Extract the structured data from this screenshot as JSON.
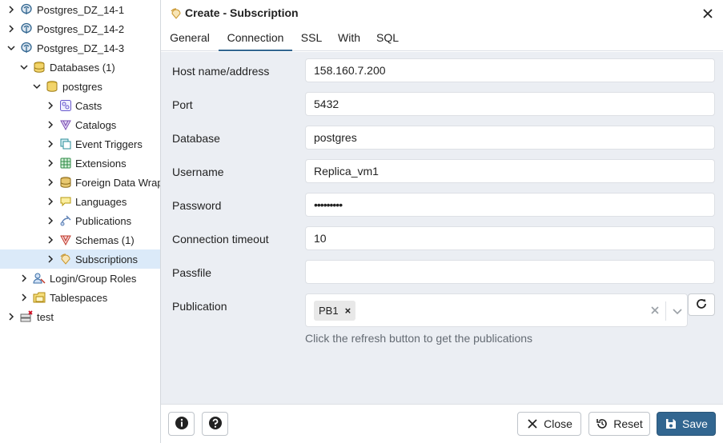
{
  "tree": {
    "items": [
      {
        "label": "Postgres_DZ_14-1",
        "icon": "postgres-server-icon",
        "expanded": false
      },
      {
        "label": "Postgres_DZ_14-2",
        "icon": "postgres-server-icon",
        "expanded": false
      },
      {
        "label": "Postgres_DZ_14-3",
        "icon": "postgres-server-icon",
        "expanded": true
      },
      {
        "label": "Databases (1)",
        "icon": "databases-icon",
        "expanded": true
      },
      {
        "label": "postgres",
        "icon": "database-icon",
        "expanded": true
      },
      {
        "label": "Casts",
        "icon": "casts-icon",
        "expanded": false
      },
      {
        "label": "Catalogs",
        "icon": "catalogs-icon",
        "expanded": false
      },
      {
        "label": "Event Triggers",
        "icon": "event-triggers-icon",
        "expanded": false
      },
      {
        "label": "Extensions",
        "icon": "extensions-icon",
        "expanded": false
      },
      {
        "label": "Foreign Data Wrap",
        "icon": "foreign-data-wrappers-icon",
        "expanded": false
      },
      {
        "label": "Languages",
        "icon": "languages-icon",
        "expanded": false
      },
      {
        "label": "Publications",
        "icon": "publications-icon",
        "expanded": false
      },
      {
        "label": "Schemas (1)",
        "icon": "schemas-icon",
        "expanded": false
      },
      {
        "label": "Subscriptions",
        "icon": "subscriptions-icon",
        "expanded": false,
        "selected": true
      },
      {
        "label": "Login/Group Roles",
        "icon": "roles-icon",
        "expanded": false
      },
      {
        "label": "Tablespaces",
        "icon": "tablespaces-icon",
        "expanded": false
      },
      {
        "label": "test",
        "icon": "disconnected-server-icon",
        "expanded": false
      }
    ]
  },
  "dialog": {
    "title": "Create - Subscription",
    "title_icon": "subscription-icon",
    "close_icon": "close-icon",
    "tabs": [
      {
        "label": "General",
        "active": false
      },
      {
        "label": "Connection",
        "active": true
      },
      {
        "label": "SSL",
        "active": false
      },
      {
        "label": "With",
        "active": false
      },
      {
        "label": "SQL",
        "active": false
      }
    ],
    "fields": {
      "host": {
        "label": "Host name/address",
        "value": "158.160.7.200"
      },
      "port": {
        "label": "Port",
        "value": "5432"
      },
      "database": {
        "label": "Database",
        "value": "postgres"
      },
      "username": {
        "label": "Username",
        "value": "Replica_vm1"
      },
      "password": {
        "label": "Password",
        "value": "•••••••••"
      },
      "timeout": {
        "label": "Connection timeout",
        "value": "10"
      },
      "passfile": {
        "label": "Passfile",
        "value": ""
      },
      "publication": {
        "label": "Publication",
        "selected": [
          "PB1"
        ]
      }
    },
    "hint": "Click the refresh button to get the publications",
    "footer": {
      "info_icon": "info-icon",
      "help_icon": "help-icon",
      "close_label": "Close",
      "reset_label": "Reset",
      "save_label": "Save"
    }
  },
  "colors": {
    "primary": "#326690",
    "selected_row": "#dbeaf9",
    "content_bg": "#ebeef3"
  }
}
